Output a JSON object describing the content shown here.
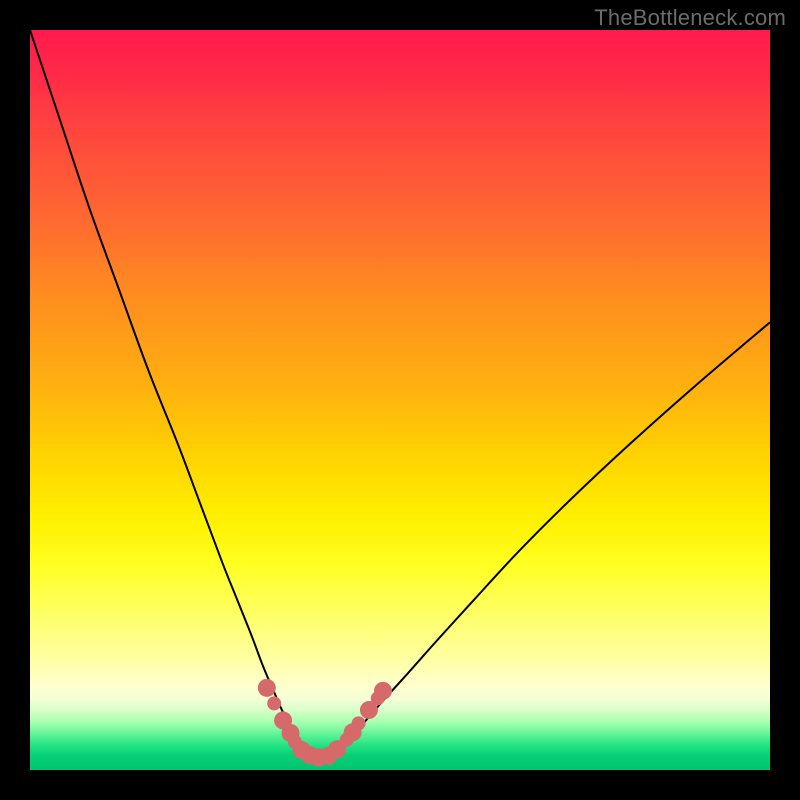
{
  "watermark": "TheBottleneck.com",
  "gradient": {
    "stops": [
      {
        "pct": 0,
        "color": "#ff1a4d"
      },
      {
        "pct": 6,
        "color": "#ff2a47"
      },
      {
        "pct": 12,
        "color": "#ff4040"
      },
      {
        "pct": 26,
        "color": "#ff6a30"
      },
      {
        "pct": 35,
        "color": "#ff8a20"
      },
      {
        "pct": 48,
        "color": "#ffb010"
      },
      {
        "pct": 58,
        "color": "#ffd400"
      },
      {
        "pct": 66,
        "color": "#fff000"
      },
      {
        "pct": 72,
        "color": "#ffff20"
      },
      {
        "pct": 79,
        "color": "#ffff66"
      },
      {
        "pct": 84,
        "color": "#ffff99"
      },
      {
        "pct": 87,
        "color": "#ffffbb"
      },
      {
        "pct": 89,
        "color": "#fdffcf"
      },
      {
        "pct": 90.5,
        "color": "#f3ffd6"
      },
      {
        "pct": 92,
        "color": "#d6ffc8"
      },
      {
        "pct": 93.5,
        "color": "#a8ffb0"
      },
      {
        "pct": 95,
        "color": "#68f59a"
      },
      {
        "pct": 96.5,
        "color": "#28e585"
      },
      {
        "pct": 98,
        "color": "#05d076"
      },
      {
        "pct": 100,
        "color": "#04c471"
      }
    ]
  },
  "chart_data": {
    "type": "line",
    "title": "",
    "xlabel": "",
    "ylabel": "",
    "xlim": [
      0,
      100
    ],
    "ylim": [
      0,
      100
    ],
    "grid": false,
    "series": [
      {
        "name": "left-branch",
        "x": [
          0,
          4,
          8,
          12,
          16,
          20,
          23,
          26,
          28,
          30,
          31.5,
          33,
          34,
          35,
          35.9,
          36.5,
          37.0,
          37.4
        ],
        "y": [
          100,
          88,
          76,
          65,
          54,
          44,
          36,
          28,
          23,
          18,
          14,
          10.5,
          8.2,
          6.3,
          4.6,
          3.4,
          2.6,
          2.0
        ]
      },
      {
        "name": "right-branch",
        "x": [
          40.5,
          41.2,
          42,
          43,
          44.5,
          46,
          48,
          51,
          55,
          60,
          66,
          73,
          81,
          90,
          100
        ],
        "y": [
          2.0,
          2.5,
          3.2,
          4.2,
          5.7,
          7.4,
          9.7,
          13.0,
          17.5,
          23.0,
          29.5,
          36.5,
          44.0,
          52.0,
          60.5
        ]
      },
      {
        "name": "floor",
        "x": [
          37.4,
          37.8,
          38.2,
          38.7,
          39.2,
          39.7,
          40.1,
          40.5
        ],
        "y": [
          2.0,
          1.8,
          1.7,
          1.65,
          1.65,
          1.7,
          1.8,
          2.0
        ]
      }
    ],
    "markers": {
      "name": "curve-markers",
      "color": "#d66a6a",
      "radius_large": 9,
      "radius_small": 7,
      "points": [
        {
          "x": 32.0,
          "y": 11.1,
          "r": "large"
        },
        {
          "x": 33.0,
          "y": 9.0,
          "r": "small"
        },
        {
          "x": 34.2,
          "y": 6.7,
          "r": "large"
        },
        {
          "x": 35.2,
          "y": 5.0,
          "r": "large"
        },
        {
          "x": 35.8,
          "y": 3.8,
          "r": "small"
        },
        {
          "x": 36.7,
          "y": 2.7,
          "r": "large"
        },
        {
          "x": 37.8,
          "y": 2.0,
          "r": "large"
        },
        {
          "x": 39.0,
          "y": 1.7,
          "r": "large"
        },
        {
          "x": 40.3,
          "y": 1.9,
          "r": "large"
        },
        {
          "x": 41.5,
          "y": 2.8,
          "r": "large"
        },
        {
          "x": 42.8,
          "y": 4.1,
          "r": "small"
        },
        {
          "x": 43.6,
          "y": 5.1,
          "r": "large"
        },
        {
          "x": 44.4,
          "y": 6.3,
          "r": "small"
        },
        {
          "x": 45.8,
          "y": 8.1,
          "r": "large"
        },
        {
          "x": 47.0,
          "y": 9.7,
          "r": "small"
        },
        {
          "x": 47.7,
          "y": 10.7,
          "r": "large"
        }
      ]
    }
  },
  "colors": {
    "curve_stroke": "#000000",
    "marker_fill": "#d66a6a",
    "background": "#000000",
    "watermark": "#6c6c6c"
  }
}
